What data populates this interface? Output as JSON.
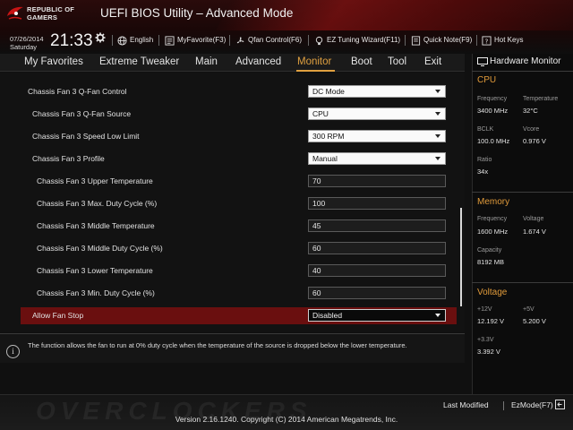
{
  "header": {
    "brand_line1": "REPUBLIC OF",
    "brand_line2": "GAMERS",
    "title": "UEFI BIOS Utility – Advanced Mode",
    "date": "07/26/2014",
    "day": "Saturday",
    "time": "21:33",
    "toolbar": {
      "language": "English",
      "myfavorite": "MyFavorite(F3)",
      "qfan": "Qfan Control(F6)",
      "ez_tuning": "EZ Tuning Wizard(F11)",
      "quick_note": "Quick Note(F9)",
      "hot_keys": "Hot Keys"
    }
  },
  "menu": {
    "tabs": [
      "My Favorites",
      "Extreme Tweaker",
      "Main",
      "Advanced",
      "Monitor",
      "Boot",
      "Tool",
      "Exit"
    ],
    "active": "Monitor"
  },
  "settings": [
    {
      "label": "Chassis Fan 3 Q-Fan Control",
      "value": "DC Mode",
      "type": "dropdown"
    },
    {
      "label": "Chassis Fan 3 Q-Fan Source",
      "value": "CPU",
      "type": "dropdown"
    },
    {
      "label": "Chassis Fan 3 Speed Low Limit",
      "value": "300 RPM",
      "type": "dropdown"
    },
    {
      "label": "Chassis Fan 3 Profile",
      "value": "Manual",
      "type": "dropdown"
    },
    {
      "label": "Chassis Fan 3 Upper Temperature",
      "value": "70",
      "type": "input"
    },
    {
      "label": "Chassis Fan 3 Max. Duty Cycle (%)",
      "value": "100",
      "type": "input"
    },
    {
      "label": "Chassis Fan 3 Middle Temperature",
      "value": "45",
      "type": "input"
    },
    {
      "label": "Chassis Fan 3 Middle Duty Cycle (%)",
      "value": "60",
      "type": "input"
    },
    {
      "label": "Chassis Fan 3 Lower Temperature",
      "value": "40",
      "type": "input"
    },
    {
      "label": "Chassis Fan 3 Min. Duty Cycle (%)",
      "value": "60",
      "type": "input"
    },
    {
      "label": "Allow Fan Stop",
      "value": "Disabled",
      "type": "dropdown",
      "selected": true
    }
  ],
  "help": {
    "icon_label": "i",
    "text": "The function allows the fan to run at 0% duty cycle when the temperature of the source is dropped below the lower temperature."
  },
  "hardware_monitor": {
    "title": "Hardware Monitor",
    "cpu": {
      "heading": "CPU",
      "frequency_label": "Frequency",
      "frequency": "3400 MHz",
      "temperature_label": "Temperature",
      "temperature": "32°C",
      "bclk_label": "BCLK",
      "bclk": "100.0 MHz",
      "vcore_label": "Vcore",
      "vcore": "0.976 V",
      "ratio_label": "Ratio",
      "ratio": "34x"
    },
    "memory": {
      "heading": "Memory",
      "frequency_label": "Frequency",
      "frequency": "1600 MHz",
      "voltage_label": "Voltage",
      "voltage": "1.674 V",
      "capacity_label": "Capacity",
      "capacity": "8192 MB"
    },
    "voltage": {
      "heading": "Voltage",
      "v12_label": "+12V",
      "v12": "12.192 V",
      "v5_label": "+5V",
      "v5": "5.200 V",
      "v33_label": "+3.3V",
      "v33": "3.392 V"
    }
  },
  "footer": {
    "watermark": "OVERCLOCKERS",
    "last_modified": "Last Modified",
    "ez_mode": "EzMode(F7)",
    "version": "Version 2.16.1240. Copyright (C) 2014 American Megatrends, Inc."
  },
  "colors": {
    "accent": "#e0a040",
    "highlight": "#6a0f0f",
    "section_heading": "#e09a3a"
  }
}
